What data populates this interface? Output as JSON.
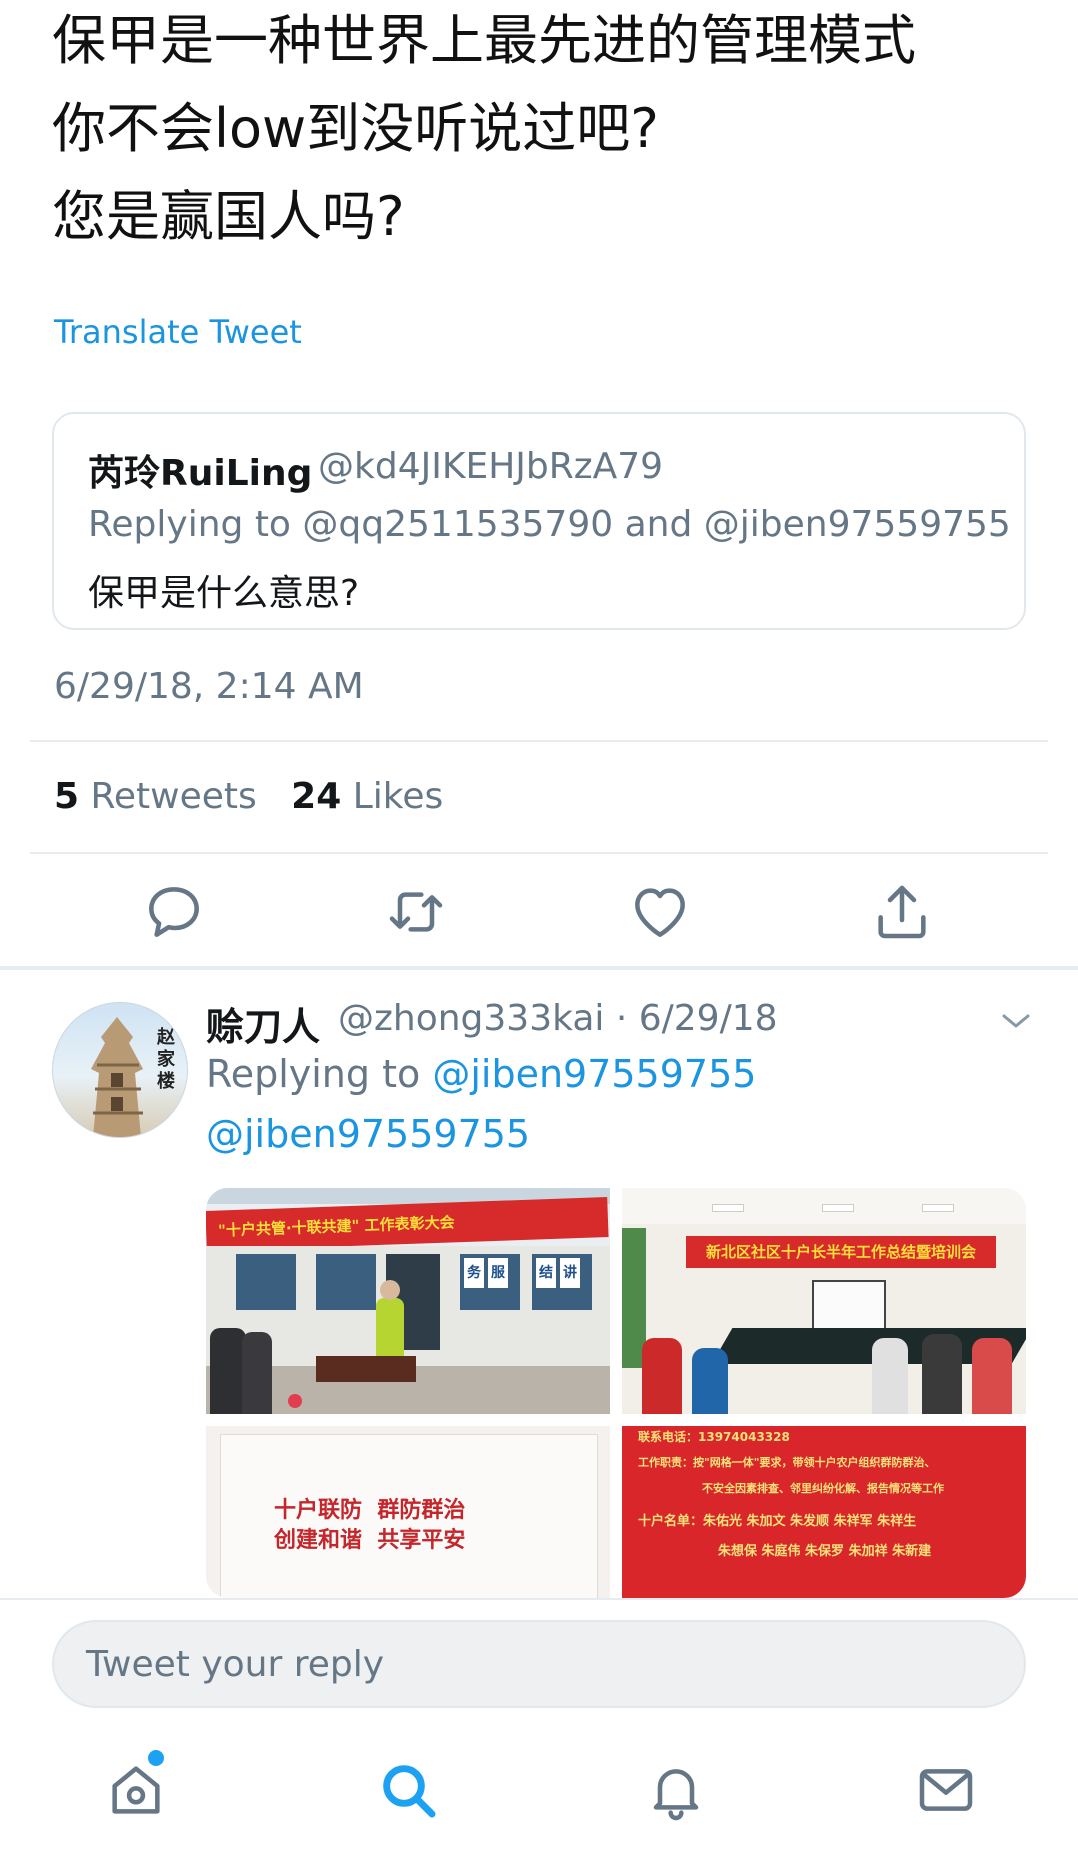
{
  "tweet": {
    "lines": [
      "保甲是一种世界上最先进的管理模式",
      "你不会low到没听说过吧?",
      "您是赢国人吗?"
    ],
    "translate_label": "Translate Tweet",
    "timestamp": "6/29/18, 2:14 AM",
    "retweets_count": "5",
    "retweets_label": "Retweets",
    "likes_count": "24",
    "likes_label": "Likes"
  },
  "quoted": {
    "name": "芮玲RuiLing",
    "handle": "@kd4JIKEHJbRzA79",
    "replying": "Replying to @qq2511535790 and @jiben97559755",
    "text": "保甲是什么意思?"
  },
  "actions": [
    {
      "icon": "reply-icon"
    },
    {
      "icon": "retweet-icon"
    },
    {
      "icon": "like-icon"
    },
    {
      "icon": "share-icon"
    }
  ],
  "reply_tweet": {
    "name": "赊刀人",
    "handle_date": "@zhong333kai · 6/29/18",
    "replying_prefix": "Replying to",
    "replying_handle": "@jiben97559755",
    "mention": "@jiben97559755",
    "avatar_text": "赵家楼",
    "photos": [
      {
        "banner": "\"十户共管·十联共建\" 工作表彰大会",
        "signs": [
          "务",
          "服",
          "结",
          "讲"
        ]
      },
      {
        "banner": "新北区社区十户长半年工作总结暨培训会"
      },
      {
        "slogan_1": "十户联防  群防群治",
        "slogan_2": "创建和谐  共享平安"
      },
      {
        "lines": [
          "联系电话：13974043328",
          "工作职责：按\"网格一体\"要求，带领十户农户组织群防群治、",
          "不安全因素排查、邻里纠纷化解、报告情况等工作",
          "十户名单：朱佑光 朱加文 朱发顺 朱祥军 朱祥生",
          "朱想保 朱庭伟 朱保罗 朱加祥 朱新建"
        ]
      }
    ]
  },
  "composer": {
    "placeholder": "Tweet your reply"
  },
  "tabbar": [
    {
      "icon": "home-icon"
    },
    {
      "icon": "search-icon"
    },
    {
      "icon": "notifications-icon"
    },
    {
      "icon": "messages-icon"
    }
  ],
  "colors": {
    "link": "#1b95e0",
    "muted": "#657786",
    "text": "#14171a",
    "divider": "#e6ecf0"
  }
}
